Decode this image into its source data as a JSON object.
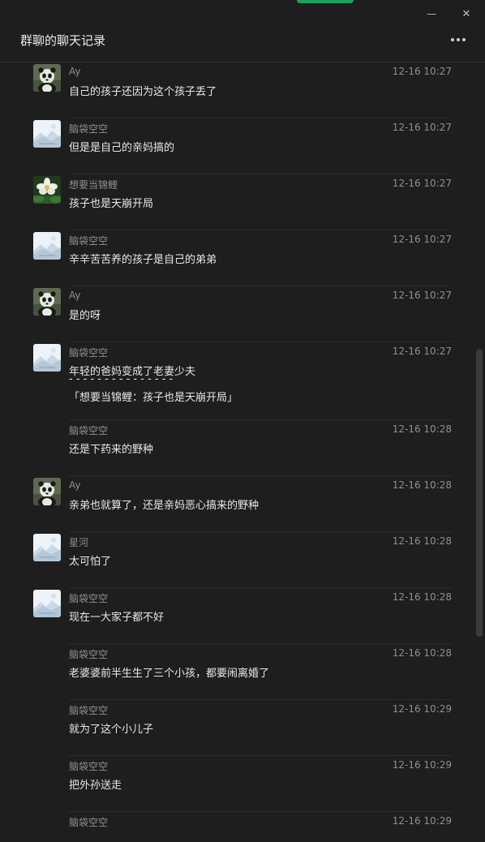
{
  "window": {
    "title": "群聊的聊天记录",
    "minimize_glyph": "—",
    "close_glyph": "✕"
  },
  "colors": {
    "background": "#1e1e1e",
    "accent": "#1fa15a",
    "sender": "#8f8f8f",
    "text": "#e8e8e8"
  },
  "messages": [
    {
      "sender": "Ay",
      "time": "12-16 10:27",
      "lines": [
        "自己的孩子还因为这个孩子丢了"
      ],
      "avatar": "panda"
    },
    {
      "sender": "脑袋空空",
      "time": "12-16 10:27",
      "lines": [
        "但是是自己的亲妈搞的"
      ],
      "avatar": "placeholder"
    },
    {
      "sender": "想要当锦鲤",
      "time": "12-16 10:27",
      "lines": [
        "孩子也是天崩开局"
      ],
      "avatar": "flower"
    },
    {
      "sender": "脑袋空空",
      "time": "12-16 10:27",
      "lines": [
        "辛辛苦苦养的孩子是自己的弟弟"
      ],
      "avatar": "placeholder"
    },
    {
      "sender": "Ay",
      "time": "12-16 10:27",
      "lines": [
        "是的呀"
      ],
      "avatar": "panda"
    },
    {
      "sender": "脑袋空空",
      "time": "12-16 10:27",
      "lines": [
        "年轻的爸妈变成了老妻少夫",
        "- - - - - - - - - - - - - - -",
        "「想要当锦鲤：孩子也是天崩开局」"
      ],
      "avatar": "placeholder"
    },
    {
      "sender": "脑袋空空",
      "time": "12-16 10:28",
      "lines": [
        "还是下药来的野种"
      ],
      "avatar": "none"
    },
    {
      "sender": "Ay",
      "time": "12-16 10:28",
      "lines": [
        "亲弟也就算了，还是亲妈恶心搞来的野种"
      ],
      "avatar": "panda"
    },
    {
      "sender": "星河",
      "time": "12-16 10:28",
      "lines": [
        "太可怕了"
      ],
      "avatar": "placeholder"
    },
    {
      "sender": "脑袋空空",
      "time": "12-16 10:28",
      "lines": [
        "现在一大家子都不好"
      ],
      "avatar": "placeholder"
    },
    {
      "sender": "脑袋空空",
      "time": "12-16 10:28",
      "lines": [
        "老婆婆前半生生了三个小孩，都要闹离婚了"
      ],
      "avatar": "none"
    },
    {
      "sender": "脑袋空空",
      "time": "12-16 10:29",
      "lines": [
        "就为了这个小儿子"
      ],
      "avatar": "none"
    },
    {
      "sender": "脑袋空空",
      "time": "12-16 10:29",
      "lines": [
        "把外孙送走"
      ],
      "avatar": "none"
    },
    {
      "sender": "脑袋空空",
      "time": "12-16 10:29",
      "lines": [],
      "avatar": "none"
    }
  ]
}
